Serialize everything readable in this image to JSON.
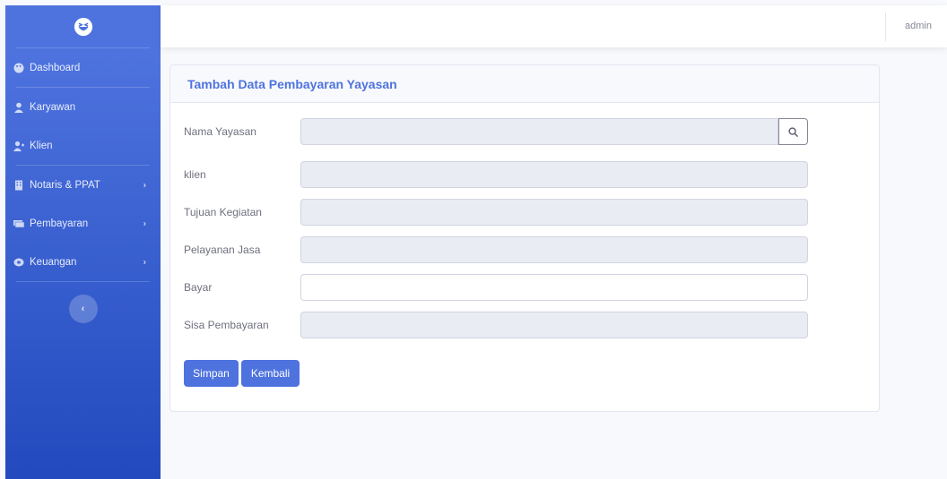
{
  "sidebar": {
    "brand_icon": "laughing-face-icon",
    "items": [
      {
        "label": "Dashboard",
        "icon": "palette-icon",
        "has_children": false
      },
      {
        "label": "Karyawan",
        "icon": "user-icon",
        "has_children": false
      },
      {
        "label": "Klien",
        "icon": "user-plus-icon",
        "has_children": false
      },
      {
        "label": "Notaris & PPAT",
        "icon": "building-icon",
        "has_children": true
      },
      {
        "label": "Pembayaran",
        "icon": "money-icon",
        "has_children": true
      },
      {
        "label": "Keuangan",
        "icon": "coins-icon",
        "has_children": true
      }
    ],
    "collapse_icon": "chevron-left-icon",
    "chevron_glyph": "›",
    "collapse_glyph": "‹"
  },
  "topbar": {
    "user_name": "admin"
  },
  "form": {
    "title": "Tambah Data Pembayaran Yayasan",
    "fields": {
      "nama_yayasan": {
        "label": "Nama Yayasan",
        "value": ""
      },
      "klien": {
        "label": "klien",
        "value": ""
      },
      "tujuan_kegiatan": {
        "label": "Tujuan Kegiatan",
        "value": ""
      },
      "pelayanan_jasa": {
        "label": "Pelayanan Jasa",
        "value": ""
      },
      "bayar": {
        "label": "Bayar",
        "value": ""
      },
      "sisa_pembayaran": {
        "label": "Sisa Pembayaran",
        "value": ""
      }
    },
    "save_label": "Simpan",
    "back_label": "Kembali"
  },
  "colors": {
    "primary": "#4e73df",
    "sidebar_gradient_end": "#224abe",
    "readonly_bg": "#eaecf4",
    "page_bg": "#f8f9fc"
  }
}
